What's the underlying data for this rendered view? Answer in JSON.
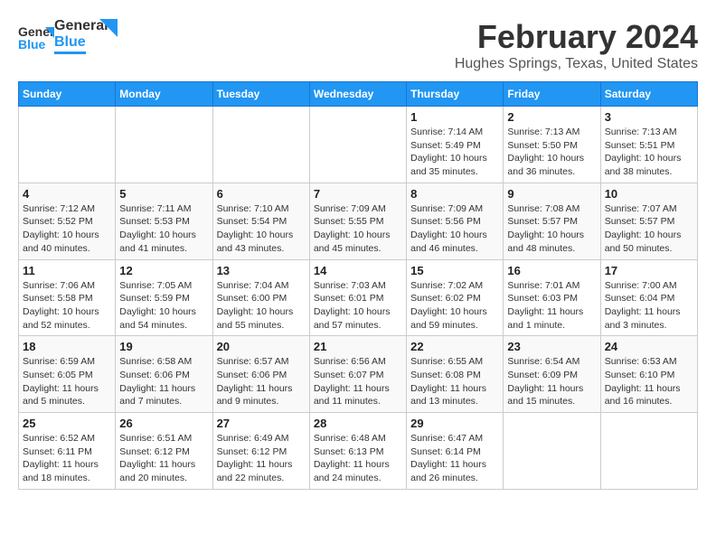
{
  "header": {
    "logo": {
      "line1": "General",
      "line2": "Blue"
    },
    "title": "February 2024",
    "location": "Hughes Springs, Texas, United States"
  },
  "calendar": {
    "days_of_week": [
      "Sunday",
      "Monday",
      "Tuesday",
      "Wednesday",
      "Thursday",
      "Friday",
      "Saturday"
    ],
    "weeks": [
      [
        {
          "day": "",
          "info": ""
        },
        {
          "day": "",
          "info": ""
        },
        {
          "day": "",
          "info": ""
        },
        {
          "day": "",
          "info": ""
        },
        {
          "day": "1",
          "info": "Sunrise: 7:14 AM\nSunset: 5:49 PM\nDaylight: 10 hours\nand 35 minutes."
        },
        {
          "day": "2",
          "info": "Sunrise: 7:13 AM\nSunset: 5:50 PM\nDaylight: 10 hours\nand 36 minutes."
        },
        {
          "day": "3",
          "info": "Sunrise: 7:13 AM\nSunset: 5:51 PM\nDaylight: 10 hours\nand 38 minutes."
        }
      ],
      [
        {
          "day": "4",
          "info": "Sunrise: 7:12 AM\nSunset: 5:52 PM\nDaylight: 10 hours\nand 40 minutes."
        },
        {
          "day": "5",
          "info": "Sunrise: 7:11 AM\nSunset: 5:53 PM\nDaylight: 10 hours\nand 41 minutes."
        },
        {
          "day": "6",
          "info": "Sunrise: 7:10 AM\nSunset: 5:54 PM\nDaylight: 10 hours\nand 43 minutes."
        },
        {
          "day": "7",
          "info": "Sunrise: 7:09 AM\nSunset: 5:55 PM\nDaylight: 10 hours\nand 45 minutes."
        },
        {
          "day": "8",
          "info": "Sunrise: 7:09 AM\nSunset: 5:56 PM\nDaylight: 10 hours\nand 46 minutes."
        },
        {
          "day": "9",
          "info": "Sunrise: 7:08 AM\nSunset: 5:57 PM\nDaylight: 10 hours\nand 48 minutes."
        },
        {
          "day": "10",
          "info": "Sunrise: 7:07 AM\nSunset: 5:57 PM\nDaylight: 10 hours\nand 50 minutes."
        }
      ],
      [
        {
          "day": "11",
          "info": "Sunrise: 7:06 AM\nSunset: 5:58 PM\nDaylight: 10 hours\nand 52 minutes."
        },
        {
          "day": "12",
          "info": "Sunrise: 7:05 AM\nSunset: 5:59 PM\nDaylight: 10 hours\nand 54 minutes."
        },
        {
          "day": "13",
          "info": "Sunrise: 7:04 AM\nSunset: 6:00 PM\nDaylight: 10 hours\nand 55 minutes."
        },
        {
          "day": "14",
          "info": "Sunrise: 7:03 AM\nSunset: 6:01 PM\nDaylight: 10 hours\nand 57 minutes."
        },
        {
          "day": "15",
          "info": "Sunrise: 7:02 AM\nSunset: 6:02 PM\nDaylight: 10 hours\nand 59 minutes."
        },
        {
          "day": "16",
          "info": "Sunrise: 7:01 AM\nSunset: 6:03 PM\nDaylight: 11 hours\nand 1 minute."
        },
        {
          "day": "17",
          "info": "Sunrise: 7:00 AM\nSunset: 6:04 PM\nDaylight: 11 hours\nand 3 minutes."
        }
      ],
      [
        {
          "day": "18",
          "info": "Sunrise: 6:59 AM\nSunset: 6:05 PM\nDaylight: 11 hours\nand 5 minutes."
        },
        {
          "day": "19",
          "info": "Sunrise: 6:58 AM\nSunset: 6:06 PM\nDaylight: 11 hours\nand 7 minutes."
        },
        {
          "day": "20",
          "info": "Sunrise: 6:57 AM\nSunset: 6:06 PM\nDaylight: 11 hours\nand 9 minutes."
        },
        {
          "day": "21",
          "info": "Sunrise: 6:56 AM\nSunset: 6:07 PM\nDaylight: 11 hours\nand 11 minutes."
        },
        {
          "day": "22",
          "info": "Sunrise: 6:55 AM\nSunset: 6:08 PM\nDaylight: 11 hours\nand 13 minutes."
        },
        {
          "day": "23",
          "info": "Sunrise: 6:54 AM\nSunset: 6:09 PM\nDaylight: 11 hours\nand 15 minutes."
        },
        {
          "day": "24",
          "info": "Sunrise: 6:53 AM\nSunset: 6:10 PM\nDaylight: 11 hours\nand 16 minutes."
        }
      ],
      [
        {
          "day": "25",
          "info": "Sunrise: 6:52 AM\nSunset: 6:11 PM\nDaylight: 11 hours\nand 18 minutes."
        },
        {
          "day": "26",
          "info": "Sunrise: 6:51 AM\nSunset: 6:12 PM\nDaylight: 11 hours\nand 20 minutes."
        },
        {
          "day": "27",
          "info": "Sunrise: 6:49 AM\nSunset: 6:12 PM\nDaylight: 11 hours\nand 22 minutes."
        },
        {
          "day": "28",
          "info": "Sunrise: 6:48 AM\nSunset: 6:13 PM\nDaylight: 11 hours\nand 24 minutes."
        },
        {
          "day": "29",
          "info": "Sunrise: 6:47 AM\nSunset: 6:14 PM\nDaylight: 11 hours\nand 26 minutes."
        },
        {
          "day": "",
          "info": ""
        },
        {
          "day": "",
          "info": ""
        }
      ]
    ]
  }
}
